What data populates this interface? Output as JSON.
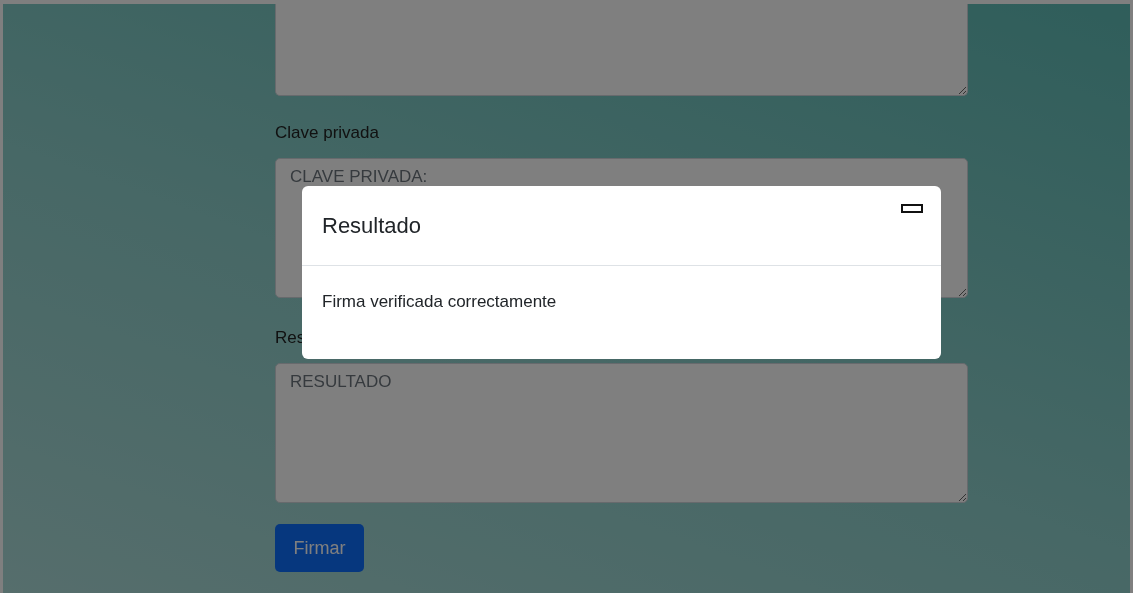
{
  "form": {
    "fields": [
      {
        "label": "Clave privada",
        "placeholder": "CLAVE PRIVADA:"
      },
      {
        "label": "Res",
        "placeholder": "RESULTADO"
      }
    ],
    "submit": "Firmar"
  },
  "modal": {
    "title": "Resultado",
    "body": "Firma verificada correctamente"
  }
}
